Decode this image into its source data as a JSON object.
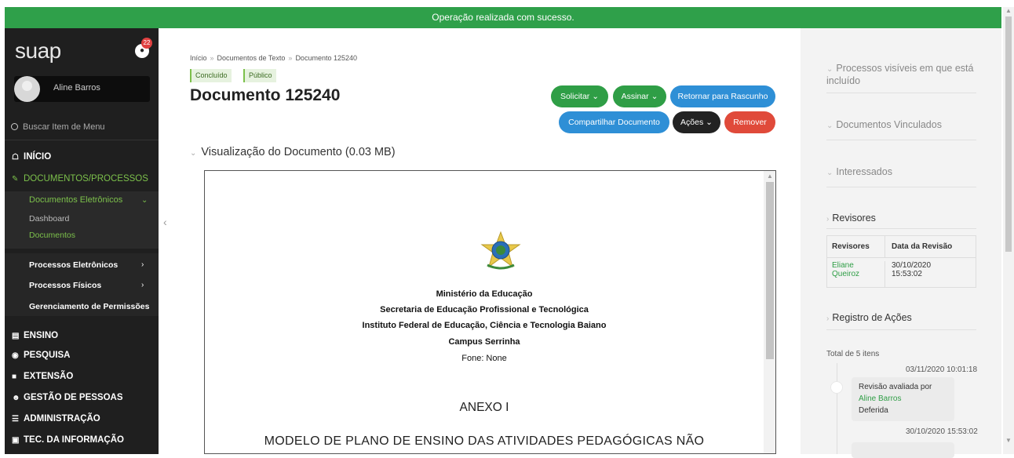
{
  "banner": {
    "message": "Operação realizada com sucesso."
  },
  "sidebar": {
    "logo": "suap",
    "notifications_count": "22",
    "user_name": "Aline Barros",
    "search_placeholder": "Buscar Item de Menu",
    "menu": {
      "inicio": "INÍCIO",
      "documentos_processos": "DOCUMENTOS/PROCESSOS",
      "documentos_eletronicos": "Documentos Eletrônicos",
      "dashboard": "Dashboard",
      "documentos": "Documentos",
      "processos_eletronicos": "Processos Eletrônicos",
      "processos_fisicos": "Processos Físicos",
      "gerenciamento": "Gerenciamento de Permissões",
      "ensino": "ENSINO",
      "pesquisa": "PESQUISA",
      "extensao": "EXTENSÃO",
      "gestao_pessoas": "GESTÃO DE PESSOAS",
      "administracao": "ADMINISTRAÇÃO",
      "tec_informacao": "TEC. DA INFORMAÇÃO"
    }
  },
  "main": {
    "breadcrumb": [
      "Início",
      "Documentos de Texto",
      "Documento 125240"
    ],
    "tags": [
      "Concluído",
      "Público"
    ],
    "title": "Documento 125240",
    "buttons": {
      "solicitar": "Solicitar",
      "assinar": "Assinar",
      "retornar": "Retornar para Rascunho",
      "compartilhar": "Compartilhar Documento",
      "acoes": "Ações",
      "remover": "Remover"
    },
    "visualizacao": "Visualização do Documento (0.03 MB)",
    "document": {
      "lines": [
        "Ministério da Educação",
        "Secretaria de Educação Profissional e Tecnológica",
        "Instituto Federal de Educação, Ciência e Tecnologia Baiano",
        "Campus Serrinha",
        "Fone: None"
      ],
      "annex": "ANEXO I",
      "heading": "MODELO DE PLANO DE ENSINO DAS ATIVIDADES PEDAGÓGICAS NÃO"
    }
  },
  "right": {
    "sections": {
      "processos": "Processos visíveis em que está incluído",
      "vinculados": "Documentos Vinculados",
      "interessados": "Interessados",
      "revisores": "Revisores",
      "registro": "Registro de Ações"
    },
    "revisores_table": {
      "headers": [
        "Revisores",
        "Data da Revisão"
      ],
      "rows": [
        {
          "name_line1": "Eliane",
          "name_line2": "Queiroz",
          "date_line1": "30/10/2020",
          "date_line2": "15:53:02"
        }
      ]
    },
    "registro": {
      "total": "Total de 5 itens",
      "entries": [
        {
          "time": "03/11/2020 10:01:18",
          "text": "Revisão avaliada por",
          "who": "Aline Barros",
          "status": "Deferida"
        },
        {
          "time": "30/10/2020 15:53:02"
        }
      ]
    }
  }
}
